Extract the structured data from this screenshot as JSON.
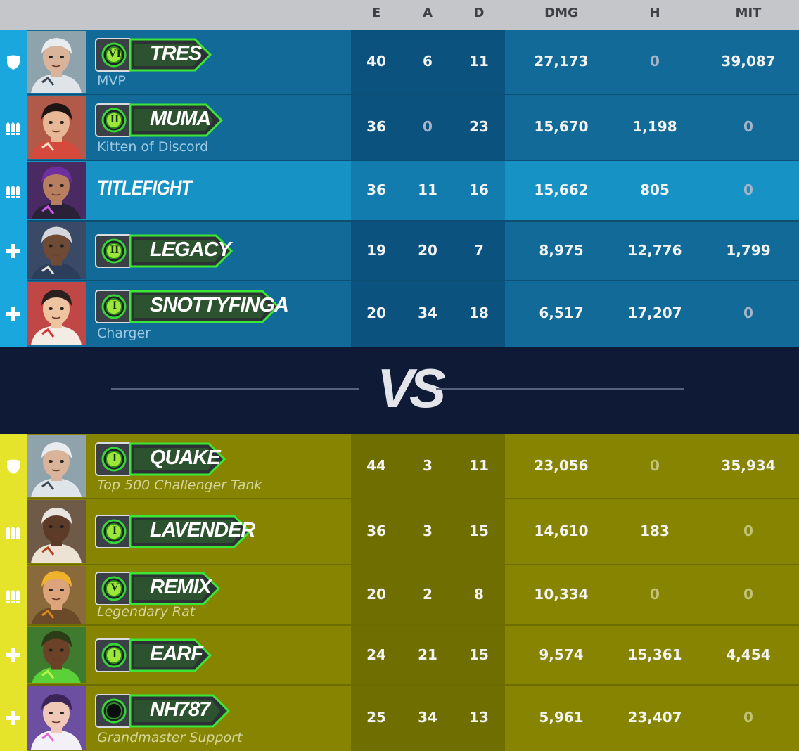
{
  "columns": [
    "E",
    "A",
    "D",
    "DMG",
    "H",
    "MIT"
  ],
  "vs_label": "VS",
  "colors": {
    "blue_team": "#116a97",
    "yellow_team": "#868400",
    "blue_stripe": "#1aa7dd",
    "yellow_stripe": "#e5e42a",
    "badge_green": "#3ce636"
  },
  "blue_team": {
    "players": [
      {
        "role": "tank",
        "role_icon": "shield-icon",
        "hero": "sigma",
        "rank": "VI",
        "name": "TRES",
        "subtitle": "MVP",
        "E": "40",
        "A": "6",
        "D": "11",
        "DMG": "27,173",
        "H": "0",
        "MIT": "39,087"
      },
      {
        "role": "damage",
        "role_icon": "bullets-icon",
        "hero": "kiriko-like",
        "rank": "II",
        "name": "MUMA",
        "subtitle": "Kitten of Discord",
        "E": "36",
        "A": "0",
        "D": "23",
        "DMG": "15,670",
        "H": "1,198",
        "MIT": "0"
      },
      {
        "role": "damage",
        "role_icon": "bullets-icon",
        "hero": "sombra",
        "rank": "",
        "name": "TITLEFIGHT",
        "subtitle": "",
        "E": "36",
        "A": "11",
        "D": "16",
        "DMG": "15,662",
        "H": "805",
        "MIT": "0"
      },
      {
        "role": "support",
        "role_icon": "plus-icon",
        "hero": "ana",
        "rank": "II",
        "name": "LEGACY",
        "subtitle": "",
        "E": "19",
        "A": "20",
        "D": "7",
        "DMG": "8,975",
        "H": "12,776",
        "MIT": "1,799"
      },
      {
        "role": "support",
        "role_icon": "plus-icon",
        "hero": "kiriko",
        "rank": "I",
        "name": "SNOTTYFINGA",
        "subtitle": "Charger",
        "E": "20",
        "A": "34",
        "D": "18",
        "DMG": "6,517",
        "H": "17,207",
        "MIT": "0"
      }
    ]
  },
  "yellow_team": {
    "players": [
      {
        "role": "tank",
        "role_icon": "shield-icon",
        "hero": "sigma",
        "rank": "I",
        "name": "QUAKE",
        "subtitle": "Top 500 Challenger Tank",
        "E": "44",
        "A": "3",
        "D": "11",
        "DMG": "23,056",
        "H": "0",
        "MIT": "35,934"
      },
      {
        "role": "damage",
        "role_icon": "bullets-icon",
        "hero": "sojourn",
        "rank": "I",
        "name": "LAVENDER",
        "subtitle": "",
        "E": "36",
        "A": "3",
        "D": "15",
        "DMG": "14,610",
        "H": "183",
        "MIT": "0"
      },
      {
        "role": "damage",
        "role_icon": "bullets-icon",
        "hero": "junkrat",
        "rank": "V",
        "name": "REMIX",
        "subtitle": "Legendary Rat",
        "E": "20",
        "A": "2",
        "D": "8",
        "DMG": "10,334",
        "H": "0",
        "MIT": "0"
      },
      {
        "role": "support",
        "role_icon": "plus-icon",
        "hero": "lucio",
        "rank": "I",
        "name": "EARF",
        "subtitle": "",
        "E": "24",
        "A": "21",
        "D": "15",
        "DMG": "9,574",
        "H": "15,361",
        "MIT": "4,454"
      },
      {
        "role": "support",
        "role_icon": "plus-icon",
        "hero": "juno",
        "rank": "",
        "name": "NH787",
        "subtitle": "Grandmaster Support",
        "E": "25",
        "A": "34",
        "D": "13",
        "DMG": "5,961",
        "H": "23,407",
        "MIT": "0"
      }
    ]
  }
}
